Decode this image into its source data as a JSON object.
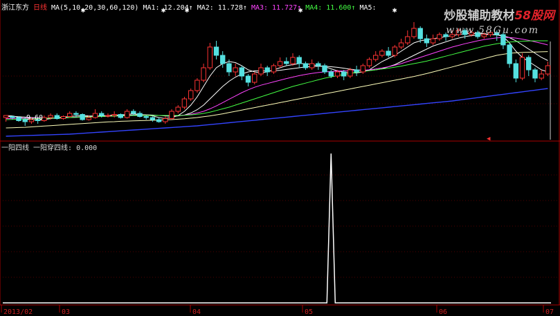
{
  "header": {
    "stock_name": "浙江东方",
    "period": "日线",
    "ma_params": "MA(5,10,20,30,60,120)",
    "ma1": "MA1: 12.204↑",
    "ma2": "MA2: 11.728↑",
    "ma3": "MA3: 11.727↑",
    "ma4": "MA4: 11.600↑",
    "ma5": "MA5:",
    "colors": {
      "ma1": "#ffffff",
      "ma2": "#ffffff",
      "ma3": "#ff44ff",
      "ma4": "#44ff44",
      "ma5": "#ffffff",
      "name": "#ffffff",
      "period": "#ff3333",
      "params": "#ffffff"
    }
  },
  "watermark": {
    "text_main": "炒股辅助教材",
    "text_accent": "58股网",
    "url": "www.58Gu.com"
  },
  "price_annotation": "9.60",
  "indicator": {
    "name": "一阳四线",
    "line_label": "一阳穿四线: 0.000"
  },
  "x_axis": {
    "labels": [
      "2013/02",
      "03",
      "04",
      "05",
      "06",
      "07"
    ]
  },
  "chart_data": [
    {
      "type": "candlestick",
      "ylim": [
        9.0,
        15.0
      ],
      "candles": [
        [
          10.0,
          10.1,
          9.8,
          10.05
        ],
        [
          10.05,
          10.0,
          9.9,
          10.1
        ],
        [
          10.0,
          9.85,
          9.8,
          10.05
        ],
        [
          9.9,
          9.8,
          9.6,
          10.0
        ],
        [
          9.8,
          9.9,
          9.7,
          10.0
        ],
        [
          9.9,
          9.85,
          9.7,
          10.0
        ],
        [
          9.85,
          10.0,
          9.8,
          10.1
        ],
        [
          10.0,
          10.1,
          9.9,
          10.2
        ],
        [
          10.1,
          9.95,
          9.9,
          10.2
        ],
        [
          9.95,
          10.05,
          9.9,
          10.1
        ],
        [
          10.05,
          10.2,
          10.0,
          10.3
        ],
        [
          10.2,
          10.15,
          10.0,
          10.3
        ],
        [
          10.15,
          9.9,
          9.85,
          10.2
        ],
        [
          9.9,
          10.0,
          9.85,
          10.1
        ],
        [
          10.0,
          10.2,
          9.95,
          10.4
        ],
        [
          10.2,
          10.1,
          10.0,
          10.3
        ],
        [
          10.1,
          10.1,
          10.0,
          10.2
        ],
        [
          10.1,
          10.15,
          10.0,
          10.3
        ],
        [
          10.15,
          10.0,
          9.95,
          10.2
        ],
        [
          10.0,
          10.3,
          9.95,
          10.4
        ],
        [
          10.3,
          10.2,
          10.1,
          10.4
        ],
        [
          10.2,
          10.05,
          10.0,
          10.3
        ],
        [
          10.05,
          10.0,
          9.9,
          10.1
        ],
        [
          10.0,
          9.9,
          9.8,
          10.05
        ],
        [
          9.9,
          9.8,
          9.75,
          10.0
        ],
        [
          9.8,
          9.95,
          9.7,
          10.05
        ],
        [
          9.95,
          10.3,
          9.9,
          10.4
        ],
        [
          10.3,
          10.5,
          10.2,
          10.6
        ],
        [
          10.5,
          10.9,
          10.4,
          11.0
        ],
        [
          10.9,
          11.3,
          10.8,
          11.4
        ],
        [
          11.3,
          11.8,
          11.2,
          11.9
        ],
        [
          11.8,
          12.4,
          11.7,
          12.6
        ],
        [
          12.4,
          13.4,
          12.3,
          13.6
        ],
        [
          13.4,
          13.0,
          12.8,
          13.7
        ],
        [
          13.0,
          12.6,
          12.4,
          13.2
        ],
        [
          12.6,
          12.2,
          12.0,
          12.8
        ],
        [
          12.2,
          12.4,
          12.0,
          12.6
        ],
        [
          12.4,
          12.0,
          11.8,
          12.5
        ],
        [
          12.0,
          11.7,
          11.5,
          12.1
        ],
        [
          11.7,
          12.1,
          11.6,
          12.2
        ],
        [
          12.1,
          12.4,
          12.0,
          12.6
        ],
        [
          12.4,
          12.2,
          12.0,
          12.5
        ],
        [
          12.2,
          12.5,
          12.1,
          12.6
        ],
        [
          12.5,
          12.7,
          12.4,
          12.9
        ],
        [
          12.7,
          12.6,
          12.5,
          12.9
        ],
        [
          12.6,
          12.9,
          12.5,
          13.1
        ],
        [
          12.9,
          12.6,
          12.4,
          13.0
        ],
        [
          12.6,
          12.4,
          12.3,
          12.7
        ],
        [
          12.4,
          12.6,
          12.3,
          12.8
        ],
        [
          12.6,
          12.5,
          12.3,
          12.7
        ],
        [
          12.5,
          12.2,
          12.1,
          12.6
        ],
        [
          12.2,
          12.0,
          11.9,
          12.3
        ],
        [
          12.0,
          12.2,
          11.9,
          12.3
        ],
        [
          12.2,
          12.0,
          11.8,
          12.3
        ],
        [
          12.0,
          12.3,
          11.9,
          12.4
        ],
        [
          12.3,
          12.2,
          12.0,
          12.5
        ],
        [
          12.2,
          12.5,
          12.1,
          12.6
        ],
        [
          12.5,
          12.8,
          12.4,
          12.9
        ],
        [
          12.8,
          13.0,
          12.7,
          13.2
        ],
        [
          13.0,
          13.2,
          12.9,
          13.3
        ],
        [
          13.2,
          13.0,
          12.9,
          13.4
        ],
        [
          13.0,
          13.4,
          12.9,
          13.5
        ],
        [
          13.4,
          13.6,
          13.3,
          13.8
        ],
        [
          13.6,
          13.9,
          13.5,
          14.2
        ],
        [
          13.9,
          14.3,
          13.8,
          14.6
        ],
        [
          14.3,
          13.8,
          13.6,
          14.4
        ],
        [
          13.8,
          13.6,
          13.4,
          14.0
        ],
        [
          13.6,
          13.8,
          13.5,
          14.0
        ],
        [
          13.8,
          14.0,
          13.7,
          14.1
        ],
        [
          14.0,
          13.9,
          13.7,
          14.1
        ],
        [
          13.9,
          14.0,
          13.8,
          14.2
        ],
        [
          14.0,
          14.2,
          13.9,
          14.3
        ],
        [
          14.2,
          14.0,
          13.8,
          14.3
        ],
        [
          14.0,
          14.1,
          13.9,
          14.2
        ],
        [
          14.1,
          13.9,
          13.8,
          14.2
        ],
        [
          13.9,
          14.0,
          13.8,
          14.1
        ],
        [
          14.0,
          14.1,
          13.9,
          14.2
        ],
        [
          14.1,
          14.0,
          13.7,
          14.2
        ],
        [
          14.0,
          13.5,
          13.3,
          14.1
        ],
        [
          13.5,
          12.6,
          12.4,
          13.6
        ],
        [
          12.6,
          11.9,
          11.7,
          12.8
        ],
        [
          11.9,
          12.9,
          11.8,
          13.1
        ],
        [
          12.9,
          12.3,
          12.0,
          13.0
        ],
        [
          12.3,
          11.9,
          11.7,
          12.4
        ],
        [
          11.9,
          12.1,
          11.8,
          12.3
        ],
        [
          12.1,
          12.5,
          12.0,
          12.7
        ]
      ],
      "ma_series": [
        {
          "name": "MA1",
          "color": "#ffffff",
          "values": [
            10.1,
            10.08,
            10.02,
            9.95,
            9.9,
            9.88,
            9.9,
            9.95,
            10.0,
            10.02,
            10.05,
            10.08,
            10.1,
            10.08,
            10.07,
            10.08,
            10.1,
            10.12,
            10.12,
            10.15,
            10.18,
            10.15,
            10.12,
            10.08,
            10.0,
            9.95,
            10.0,
            10.1,
            10.3,
            10.6,
            11.0,
            11.5,
            12.0,
            12.4,
            12.6,
            12.7,
            12.65,
            12.5,
            12.3,
            12.2,
            12.15,
            12.2,
            12.3,
            12.4,
            12.5,
            12.55,
            12.6,
            12.6,
            12.55,
            12.5,
            12.45,
            12.35,
            12.25,
            12.2,
            12.15,
            12.15,
            12.2,
            12.3,
            12.5,
            12.7,
            12.85,
            13.0,
            13.2,
            13.4,
            13.6,
            13.7,
            13.75,
            13.8,
            13.85,
            13.9,
            13.95,
            14.0,
            14.05,
            14.05,
            14.05,
            14.05,
            14.0,
            14.0,
            13.9,
            13.6,
            13.2,
            12.9,
            12.7,
            12.5,
            12.3,
            12.2
          ]
        },
        {
          "name": "MA2",
          "color": "#ffffff",
          "values": [
            10.05,
            10.05,
            10.04,
            10.02,
            10.0,
            9.98,
            9.96,
            9.96,
            9.97,
            9.98,
            10.0,
            10.02,
            10.04,
            10.05,
            10.06,
            10.07,
            10.08,
            10.09,
            10.1,
            10.11,
            10.12,
            10.13,
            10.13,
            10.12,
            10.1,
            10.08,
            10.06,
            10.08,
            10.12,
            10.22,
            10.38,
            10.6,
            10.9,
            11.2,
            11.5,
            11.75,
            11.95,
            12.1,
            12.2,
            12.25,
            12.25,
            12.25,
            12.25,
            12.28,
            12.32,
            12.36,
            12.4,
            12.44,
            12.46,
            12.47,
            12.47,
            12.45,
            12.42,
            12.38,
            12.33,
            12.3,
            12.28,
            12.27,
            12.3,
            12.35,
            12.45,
            12.55,
            12.7,
            12.85,
            13.0,
            13.15,
            13.3,
            13.45,
            13.55,
            13.65,
            13.75,
            13.83,
            13.9,
            13.95,
            13.98,
            14.0,
            14.0,
            13.98,
            13.95,
            13.85,
            13.7,
            13.5,
            13.3,
            13.1,
            12.9,
            12.75
          ]
        },
        {
          "name": "MA3",
          "color": "#ff44ff",
          "values": [
            9.95,
            9.96,
            9.97,
            9.97,
            9.97,
            9.97,
            9.97,
            9.97,
            9.98,
            9.99,
            10.0,
            10.01,
            10.02,
            10.03,
            10.04,
            10.05,
            10.06,
            10.07,
            10.08,
            10.09,
            10.1,
            10.1,
            10.1,
            10.1,
            10.1,
            10.1,
            10.1,
            10.1,
            10.12,
            10.16,
            10.22,
            10.3,
            10.42,
            10.56,
            10.72,
            10.88,
            11.04,
            11.2,
            11.34,
            11.46,
            11.56,
            11.64,
            11.72,
            11.8,
            11.88,
            11.95,
            12.02,
            12.08,
            12.13,
            12.17,
            12.2,
            12.22,
            12.24,
            12.25,
            12.26,
            12.27,
            12.28,
            12.3,
            12.34,
            12.39,
            12.45,
            12.52,
            12.6,
            12.7,
            12.8,
            12.9,
            13.0,
            13.1,
            13.2,
            13.3,
            13.4,
            13.48,
            13.56,
            13.63,
            13.7,
            13.76,
            13.8,
            13.84,
            13.86,
            13.86,
            13.83,
            13.78,
            13.72,
            13.65,
            13.58,
            13.5
          ]
        },
        {
          "name": "MA4",
          "color": "#44ff44",
          "values": [
            9.9,
            9.91,
            9.92,
            9.93,
            9.94,
            9.95,
            9.96,
            9.97,
            9.98,
            9.99,
            10.0,
            10.01,
            10.02,
            10.03,
            10.04,
            10.05,
            10.06,
            10.07,
            10.08,
            10.09,
            10.1,
            10.1,
            10.1,
            10.1,
            10.1,
            10.1,
            10.1,
            10.1,
            10.11,
            10.13,
            10.16,
            10.2,
            10.26,
            10.34,
            10.42,
            10.5,
            10.6,
            10.7,
            10.8,
            10.9,
            11.0,
            11.1,
            11.2,
            11.3,
            11.4,
            11.5,
            11.58,
            11.66,
            11.74,
            11.82,
            11.9,
            11.96,
            12.02,
            12.08,
            12.13,
            12.18,
            12.22,
            12.26,
            12.3,
            12.34,
            12.38,
            12.43,
            12.48,
            12.54,
            12.6,
            12.66,
            12.72,
            12.8,
            12.88,
            12.96,
            13.04,
            13.12,
            13.2,
            13.28,
            13.36,
            13.44,
            13.5,
            13.56,
            13.6,
            13.64,
            13.66,
            13.68,
            13.69,
            13.7,
            13.7,
            13.7
          ]
        },
        {
          "name": "MA5",
          "color": "#ffffbb",
          "values": [
            9.5,
            9.51,
            9.52,
            9.53,
            9.55,
            9.57,
            9.59,
            9.61,
            9.63,
            9.65,
            9.67,
            9.69,
            9.71,
            9.73,
            9.75,
            9.77,
            9.79,
            9.8,
            9.82,
            9.83,
            9.84,
            9.85,
            9.86,
            9.87,
            9.88,
            9.89,
            9.9,
            9.92,
            9.94,
            9.97,
            10.0,
            10.04,
            10.08,
            10.13,
            10.18,
            10.24,
            10.3,
            10.36,
            10.42,
            10.48,
            10.54,
            10.6,
            10.66,
            10.72,
            10.78,
            10.84,
            10.9,
            10.96,
            11.02,
            11.08,
            11.14,
            11.2,
            11.26,
            11.32,
            11.38,
            11.44,
            11.5,
            11.56,
            11.62,
            11.68,
            11.74,
            11.8,
            11.86,
            11.92,
            11.98,
            12.05,
            12.12,
            12.2,
            12.28,
            12.36,
            12.44,
            12.52,
            12.6,
            12.68,
            12.76,
            12.84,
            12.92,
            13.0,
            13.05,
            13.1,
            13.12,
            13.14,
            13.15,
            13.16,
            13.17,
            13.18
          ]
        },
        {
          "name": "MA6",
          "color": "#3344ff",
          "values": [
            9.1,
            9.11,
            9.12,
            9.13,
            9.14,
            9.15,
            9.16,
            9.17,
            9.18,
            9.19,
            9.2,
            9.22,
            9.24,
            9.26,
            9.28,
            9.3,
            9.32,
            9.34,
            9.36,
            9.38,
            9.4,
            9.42,
            9.44,
            9.46,
            9.48,
            9.5,
            9.52,
            9.54,
            9.56,
            9.58,
            9.6,
            9.63,
            9.66,
            9.69,
            9.72,
            9.75,
            9.78,
            9.81,
            9.84,
            9.87,
            9.9,
            9.93,
            9.96,
            9.99,
            10.02,
            10.05,
            10.08,
            10.11,
            10.14,
            10.17,
            10.2,
            10.23,
            10.26,
            10.29,
            10.32,
            10.35,
            10.38,
            10.41,
            10.44,
            10.47,
            10.5,
            10.53,
            10.56,
            10.59,
            10.62,
            10.65,
            10.68,
            10.71,
            10.74,
            10.77,
            10.8,
            10.84,
            10.88,
            10.92,
            10.96,
            11.0,
            11.04,
            11.08,
            11.12,
            11.16,
            11.2,
            11.24,
            11.28,
            11.32,
            11.36,
            11.4
          ]
        }
      ]
    },
    {
      "type": "line",
      "name": "一阳穿四线",
      "ylim": [
        0,
        1
      ],
      "spike_index": 51,
      "values": "all zero except spike_index = 1"
    }
  ]
}
